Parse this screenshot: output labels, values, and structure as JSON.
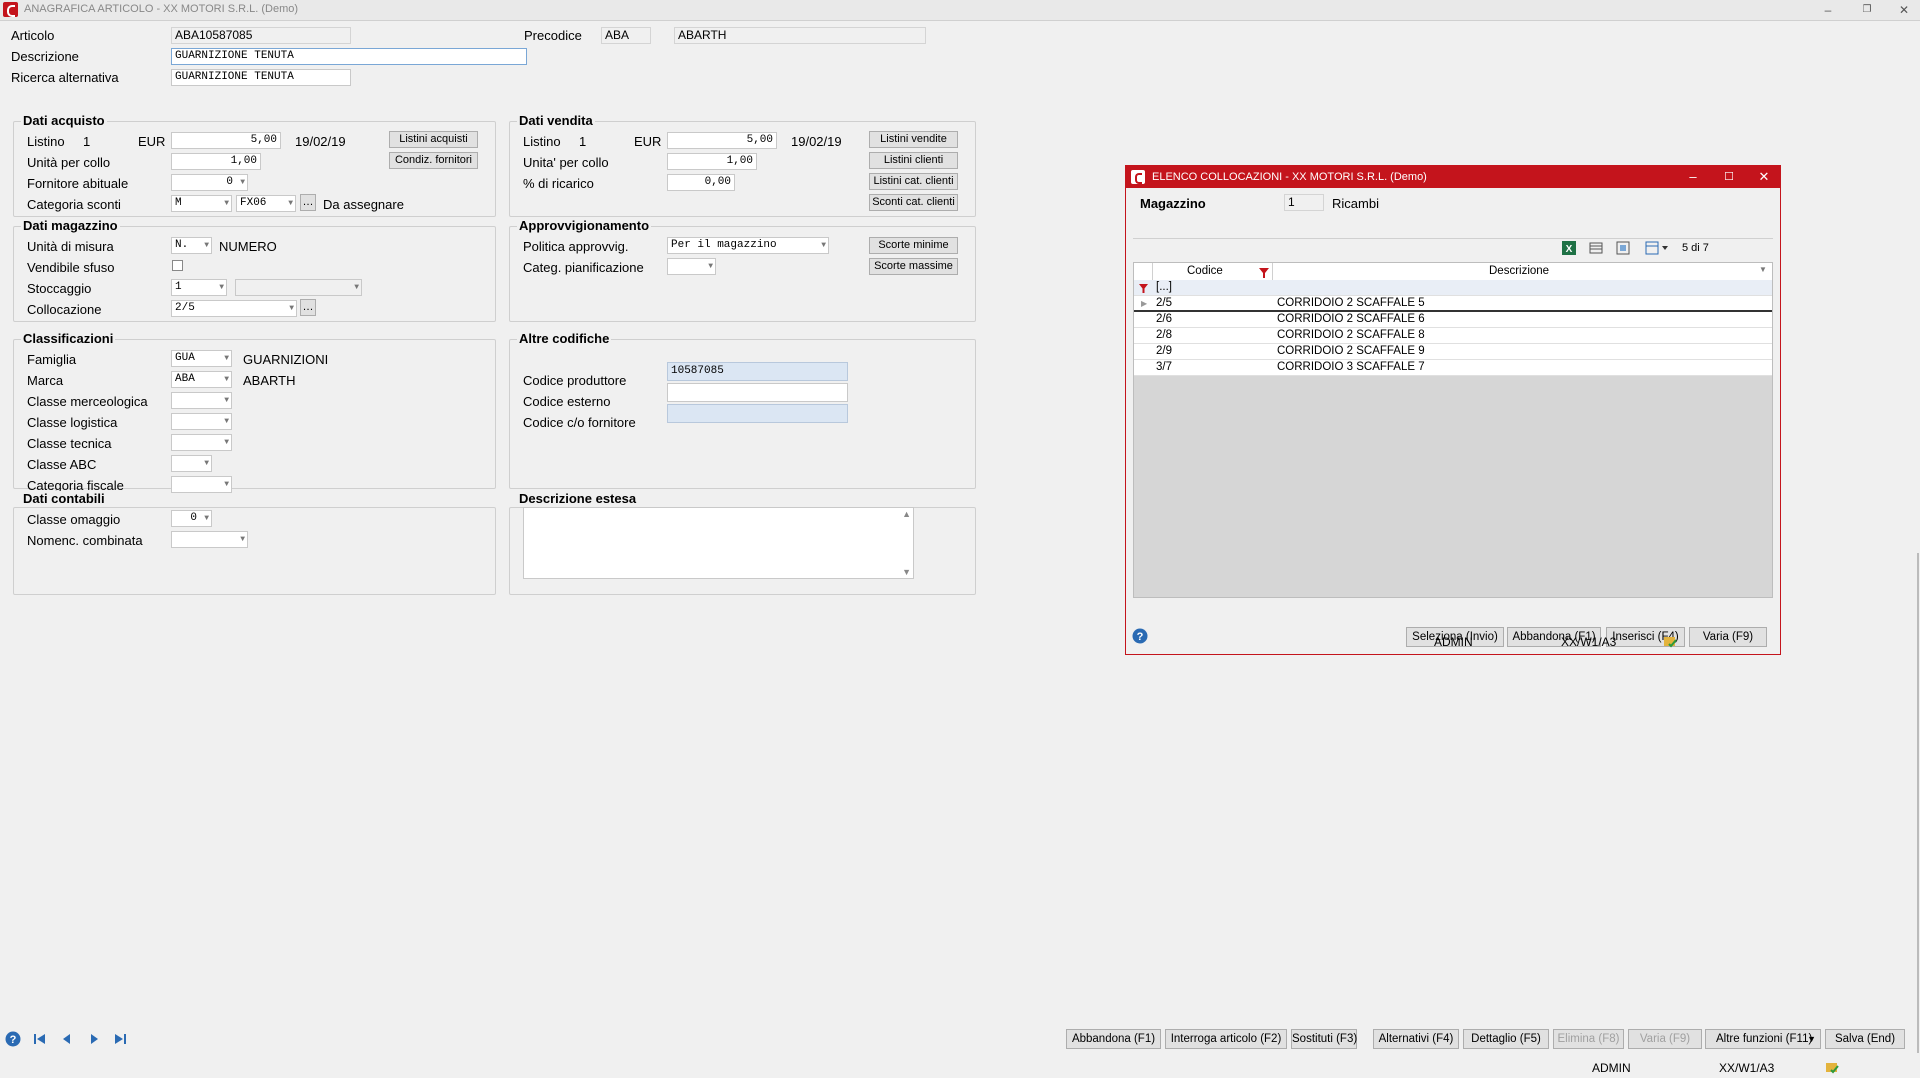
{
  "window": {
    "title": "ANAGRAFICA ARTICOLO - XX  MOTORI S.R.L.  (Demo)"
  },
  "header": {
    "articolo_label": "Articolo",
    "articolo_value": "ABA10587085",
    "descrizione_label": "Descrizione",
    "descrizione_value": "GUARNIZIONE TENUTA",
    "ricerca_label": "Ricerca alternativa",
    "ricerca_value": "GUARNIZIONE TENUTA",
    "precodice_label": "Precodice",
    "precodice_code": "ABA",
    "precodice_desc": "ABARTH"
  },
  "acquisto": {
    "title": "Dati acquisto",
    "listino_label": "Listino",
    "listino_num": "1",
    "currency": "EUR",
    "price": "5,00",
    "date": "19/02/19",
    "unita_label": "Unità per collo",
    "unita_value": "1,00",
    "fornitore_label": "Fornitore abituale",
    "fornitore_value": "0",
    "categoria_label": "Categoria sconti",
    "categoria_value1": "M",
    "categoria_value2": "FX06",
    "categoria_desc": "Da assegnare",
    "btn_listini": "Listini acquisti",
    "btn_condiz": "Condiz. fornitori"
  },
  "vendita": {
    "title": "Dati vendita",
    "listino_label": "Listino",
    "listino_num": "1",
    "currency": "EUR",
    "price": "5,00",
    "date": "19/02/19",
    "unita_label": "Unita' per collo",
    "unita_value": "1,00",
    "ricarico_label": "% di ricarico",
    "ricarico_value": "0,00",
    "btn_listini_vendite": "Listini vendite",
    "btn_listini_clienti": "Listini clienti",
    "btn_listini_cat": "Listini cat. clienti",
    "btn_sconti_cat": "Sconti cat. clienti"
  },
  "magazzino": {
    "title": "Dati magazzino",
    "um_label": "Unità di misura",
    "um_value": "N.",
    "um_desc": "NUMERO",
    "sfuso_label": "Vendibile sfuso",
    "stoccaggio_label": "Stoccaggio",
    "stoccaggio_value": "1",
    "collocazione_label": "Collocazione",
    "collocazione_value": "2/5"
  },
  "approvvigionamento": {
    "title": "Approvvigionamento",
    "politica_label": "Politica approvvig.",
    "politica_value": "Per il magazzino",
    "categ_label": "Categ. pianificazione",
    "btn_scorte_min": "Scorte minime",
    "btn_scorte_max": "Scorte massime"
  },
  "classificazioni": {
    "title": "Classificazioni",
    "famiglia_label": "Famiglia",
    "famiglia_value": "GUA",
    "famiglia_desc": "GUARNIZIONI",
    "marca_label": "Marca",
    "marca_value": "ABA",
    "marca_desc": "ABARTH",
    "merceologica_label": "Classe merceologica",
    "logistica_label": "Classe logistica",
    "tecnica_label": "Classe tecnica",
    "abc_label": "Classe ABC",
    "fiscale_label": "Categoria fiscale"
  },
  "altre_codifiche": {
    "title": "Altre codifiche",
    "produttore_label": "Codice produttore",
    "produttore_value": "10587085",
    "esterno_label": "Codice esterno",
    "fornitore_label": "Codice c/o fornitore"
  },
  "contabili": {
    "title": "Dati contabili",
    "omaggio_label": "Classe omaggio",
    "omaggio_value": "0",
    "nomenc_label": "Nomenc. combinata"
  },
  "estesa": {
    "title": "Descrizione estesa"
  },
  "footer": {
    "buttons": [
      "Abbandona (F1)",
      "Interroga articolo (F2)",
      "Sostituti (F3)",
      "Alternativi (F4)",
      "Dettaglio (F5)",
      "Elimina (F8)",
      "Varia (F9)",
      "Altre funzioni (F11)",
      "Salva (End)"
    ],
    "user": "ADMIN",
    "terminal": "XX/W1/A3"
  },
  "dialog": {
    "title": "ELENCO COLLOCAZIONI - XX  MOTORI S.R.L.  (Demo)",
    "magazzino_label": "Magazzino",
    "magazzino_value": "1",
    "magazzino_desc": "Ricambi",
    "count": "5 di 7",
    "col_codice": "Codice",
    "col_descrizione": "Descrizione",
    "filter_value": "[...]",
    "rows": [
      {
        "codice": "2/5",
        "descrizione": "CORRIDOIO 2 SCAFFALE 5"
      },
      {
        "codice": "2/6",
        "descrizione": "CORRIDOIO 2 SCAFFALE 6"
      },
      {
        "codice": "2/8",
        "descrizione": "CORRIDOIO 2 SCAFFALE 8"
      },
      {
        "codice": "2/9",
        "descrizione": "CORRIDOIO 2 SCAFFALE 9"
      },
      {
        "codice": "3/7",
        "descrizione": "CORRIDOIO 3 SCAFFALE 7"
      }
    ],
    "btn_seleziona": "Seleziona (Invio)",
    "btn_abbandona": "Abbandona (F1)",
    "btn_inserisci": "Inserisci (F4)",
    "btn_varia": "Varia (F9)",
    "user": "ADMIN",
    "terminal": "XX/W1/A3"
  }
}
